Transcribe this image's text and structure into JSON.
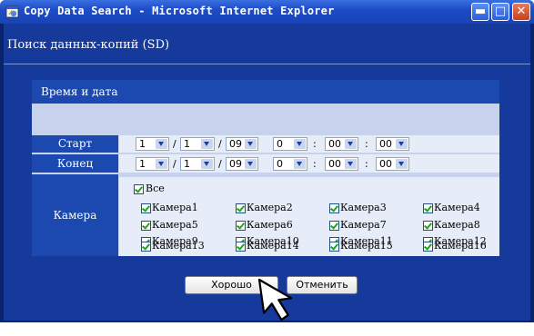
{
  "window": {
    "title": "Copy Data Search - Microsoft Internet Explorer"
  },
  "page": {
    "heading": "Поиск данных-копий (SD)"
  },
  "panel": {
    "title": "Время и дата",
    "start_label": "Старт",
    "end_label": "Конец",
    "camera_label": "Камера",
    "start": {
      "month": "1",
      "day": "1",
      "year": "09",
      "hour": "0",
      "minute": "00",
      "second": "00"
    },
    "end": {
      "month": "1",
      "day": "1",
      "year": "09",
      "hour": "0",
      "minute": "00",
      "second": "00"
    },
    "separators": {
      "date": "/",
      "time": ":"
    },
    "all_label": "Все",
    "cameras": [
      "Камера1",
      "Камера2",
      "Камера3",
      "Камера4",
      "Камера5",
      "Камера6",
      "Камера7",
      "Камера8",
      "Камера9",
      "Камера10",
      "Камера11",
      "Камера12",
      "Камера13",
      "Камера14",
      "Камера15",
      "Камера16"
    ]
  },
  "buttons": {
    "ok": "Хорошо",
    "cancel": "Отменить"
  },
  "icons": {
    "title": "ie-icon",
    "minimize": "minimize-icon",
    "maximize": "maximize-icon",
    "close": "close-icon",
    "cursor": "mouse-pointer-icon"
  },
  "colors": {
    "titlebar": "#1e4cc7",
    "client_bg": "#16399c",
    "panel_header": "#1b49b0",
    "panel_bg": "#c7d3ec",
    "row_bg": "#e7edf8",
    "check": "#21a121"
  }
}
